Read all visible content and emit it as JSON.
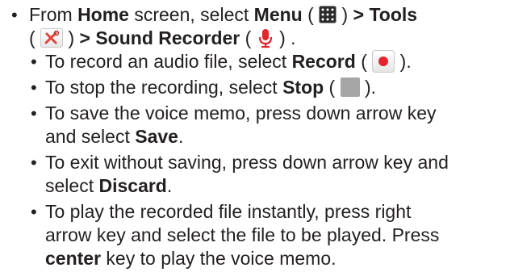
{
  "lines": {
    "l1": {
      "bullet": "•",
      "t1": "From ",
      "b1": "Home",
      "t2": " screen, select ",
      "b2": "Menu",
      "t3": " ( ",
      "t4": " ) ",
      "b3": "> Tools"
    },
    "l2": {
      "t1": "( ",
      "t2": " ) ",
      "b1": "> Sound Recorder",
      "t3": " ( ",
      "t4": " ) ."
    },
    "l3": {
      "bullet": "•",
      "t1": "To record an audio file, select ",
      "b1": "Record",
      "t2": " ( ",
      "t3": " )."
    },
    "l4": {
      "bullet": "•",
      "t1": "To stop the recording, select ",
      "b1": "Stop",
      "t2": " ( ",
      "t3": " )."
    },
    "l5": {
      "bullet": "•",
      "t1": "To save the voice memo, press down arrow key"
    },
    "l6": {
      "t1": "and select ",
      "b1": "Save",
      "t2": "."
    },
    "l7": {
      "bullet": "•",
      "t1": "To exit without saving, press down arrow key and"
    },
    "l8": {
      "t1": "select ",
      "b1": "Discard",
      "t2": "."
    },
    "l9": {
      "bullet": "•",
      "t1": "To play the recorded file instantly, press right"
    },
    "l10": {
      "t1": "arrow key and select the file to be played. Press"
    },
    "l11": {
      "b1": "center",
      "t1": " key to play the voice memo."
    }
  },
  "icons": {
    "menu": "menu-grid-icon",
    "tools": "tools-icon",
    "sound_recorder": "microphone-icon",
    "record": "record-icon",
    "stop": "stop-icon"
  },
  "colors": {
    "text": "#231f20",
    "record_red": "#e5252b",
    "stop_gray": "#a6a6a6"
  }
}
